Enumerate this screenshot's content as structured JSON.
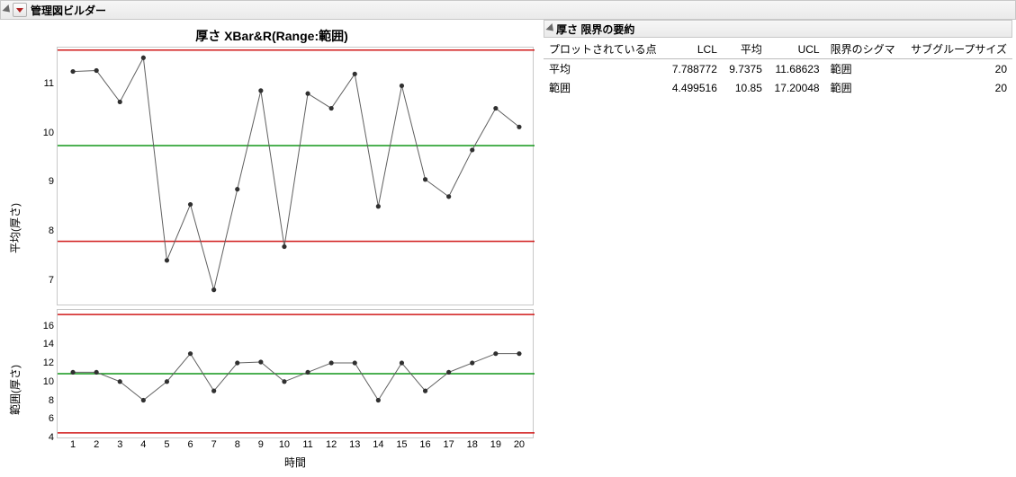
{
  "header": {
    "title": "管理図ビルダー"
  },
  "chart_title": "厚さ  XBar&R(Range:範囲)",
  "xlabel": "時間",
  "ylabel_top": "平均(厚さ)",
  "ylabel_bottom": "範囲(厚さ)",
  "summary": {
    "title": "厚さ 限界の要約",
    "headers": {
      "point": "プロットされている点",
      "lcl": "LCL",
      "mean": "平均",
      "ucl": "UCL",
      "sigma": "限界のシグマ",
      "subgroup": "サブグループサイズ"
    },
    "rows": [
      {
        "point": "平均",
        "lcl": "7.788772",
        "mean": "9.7375",
        "ucl": "11.68623",
        "sigma": "範囲",
        "subgroup": "20"
      },
      {
        "point": "範囲",
        "lcl": "4.499516",
        "mean": "10.85",
        "ucl": "17.20048",
        "sigma": "範囲",
        "subgroup": "20"
      }
    ]
  },
  "chart_data": [
    {
      "type": "line",
      "name": "XBar",
      "ylabel": "平均(厚さ)",
      "ylim": [
        6.5,
        11.7
      ],
      "yticks": [
        7,
        8,
        9,
        10,
        11
      ],
      "x": [
        1,
        2,
        3,
        4,
        5,
        6,
        7,
        8,
        9,
        10,
        11,
        12,
        13,
        14,
        15,
        16,
        17,
        18,
        19,
        20
      ],
      "values": [
        11.25,
        11.27,
        10.63,
        11.53,
        7.4,
        8.54,
        6.8,
        8.85,
        10.86,
        7.68,
        10.8,
        10.5,
        11.2,
        8.5,
        10.96,
        9.05,
        8.7,
        9.65,
        10.5,
        10.12
      ],
      "center": 9.7375,
      "lcl": 7.788772,
      "ucl": 11.68623
    },
    {
      "type": "line",
      "name": "R",
      "ylabel": "範囲(厚さ)",
      "ylim": [
        4,
        17.5
      ],
      "yticks": [
        4,
        6,
        8,
        10,
        12,
        14,
        16
      ],
      "x": [
        1,
        2,
        3,
        4,
        5,
        6,
        7,
        8,
        9,
        10,
        11,
        12,
        13,
        14,
        15,
        16,
        17,
        18,
        19,
        20
      ],
      "values": [
        11.0,
        11.0,
        10.0,
        8.0,
        10.0,
        13.0,
        9.0,
        12.0,
        12.1,
        10.0,
        11.0,
        12.0,
        12.0,
        8.0,
        12.0,
        9.0,
        11.0,
        12.0,
        13.0,
        13.0
      ],
      "center": 10.85,
      "lcl": 4.499516,
      "ucl": 17.20048
    }
  ]
}
